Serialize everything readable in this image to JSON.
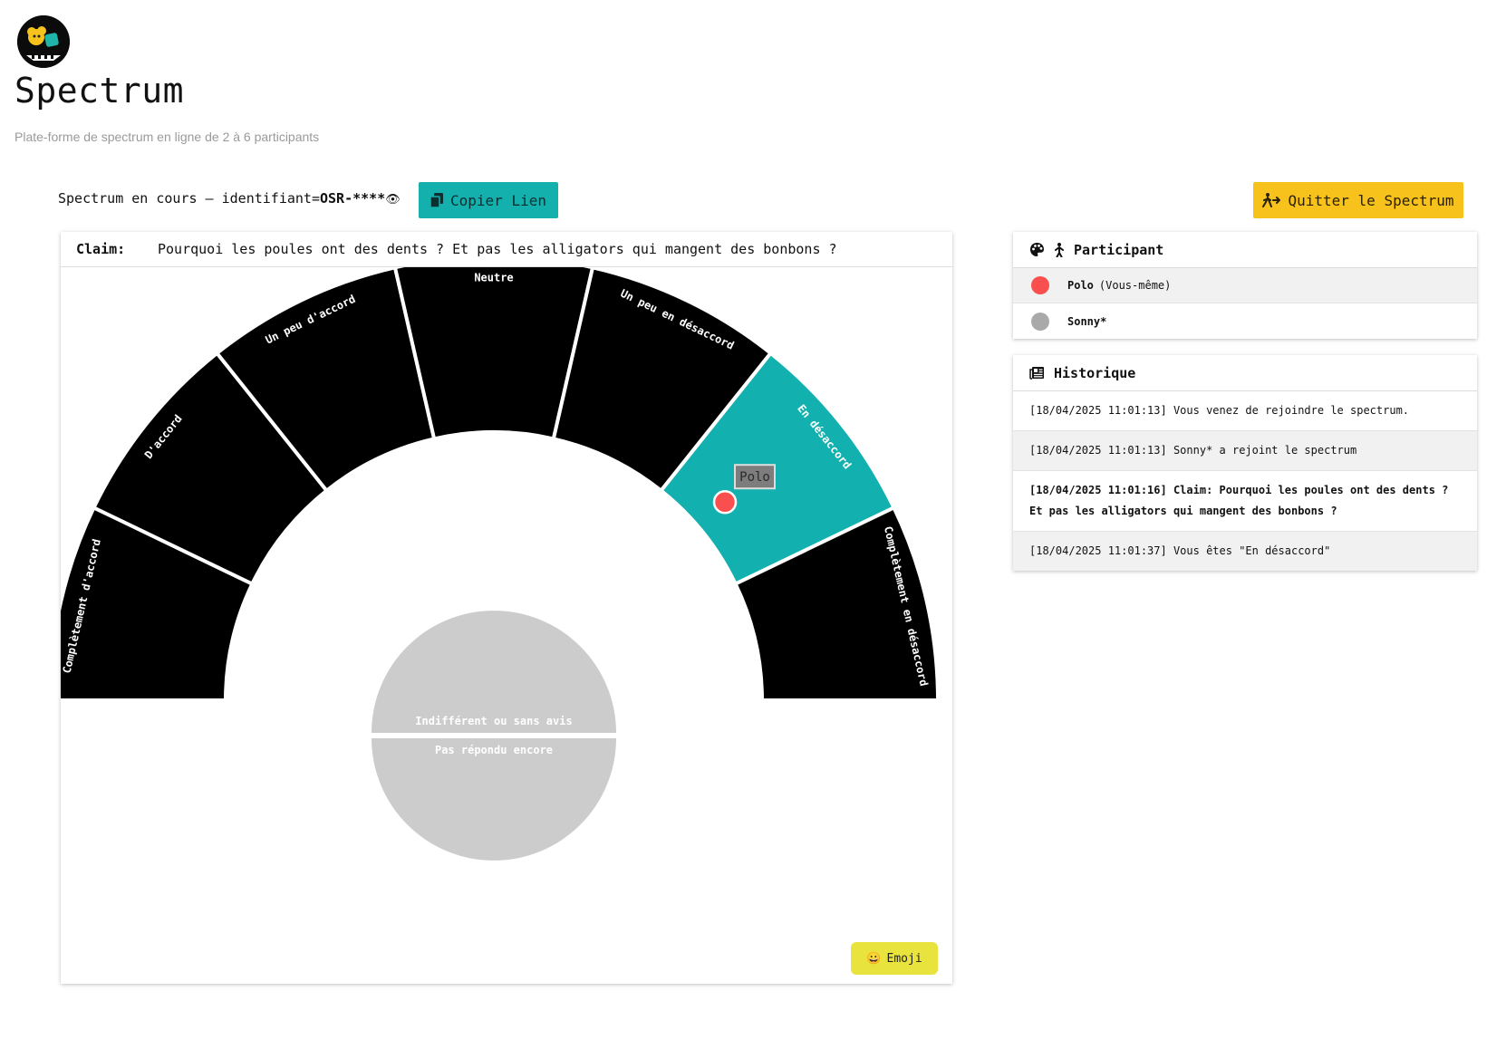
{
  "app": {
    "title": "Spectrum",
    "subtitle": "Plate-forme de spectrum en ligne de 2 à 6 participants"
  },
  "status": {
    "prefix": "Spectrum en cours – identifiant=",
    "id": "OSR-****",
    "eye_glyph": "👁"
  },
  "buttons": {
    "copy_label": "Copier Lien",
    "quit_label": "Quitter le Spectrum",
    "emoji_label": "Emoji",
    "emoji_glyph": "😀"
  },
  "claim": {
    "label": "Claim:",
    "text": "Pourquoi les poules ont des dents ? Et pas les alligators qui mangent des bonbons ?"
  },
  "spectrum": {
    "segments": [
      {
        "label": "Complètement d'accord",
        "selected": false
      },
      {
        "label": "D'accord",
        "selected": false
      },
      {
        "label": "Un peu d'accord",
        "selected": false
      },
      {
        "label": "Neutre",
        "selected": false
      },
      {
        "label": "Un peu en désaccord",
        "selected": false
      },
      {
        "label": "En désaccord",
        "selected": true
      },
      {
        "label": "Complètement en désaccord",
        "selected": false
      }
    ],
    "center_top_label": "Indifférent ou sans avis",
    "center_bottom_label": "Pas répondu encore",
    "marker_label": "Polo",
    "colors": {
      "segment": "#000000",
      "selected": "#12b0ae",
      "center": "#cccccc",
      "marker": "#f9504f"
    }
  },
  "participants": {
    "header": "Participant",
    "items": [
      {
        "name": "Polo",
        "note": "(Vous-même)",
        "color": "#f9504f"
      },
      {
        "name": "Sonny*",
        "note": "",
        "color": "#a9a9a9"
      }
    ]
  },
  "history": {
    "header": "Historique",
    "items": [
      {
        "text": "[18/04/2025 11:01:13] Vous venez de rejoindre le spectrum.",
        "bold": false
      },
      {
        "text": "[18/04/2025 11:01:13] Sonny* a rejoint le spectrum",
        "bold": false
      },
      {
        "text": "[18/04/2025 11:01:16] Claim: Pourquoi les poules ont des dents ? Et pas les alligators qui mangent des bonbons ?",
        "bold": true
      },
      {
        "text": "[18/04/2025 11:01:37] Vous êtes \"En désaccord\"",
        "bold": false
      }
    ]
  }
}
